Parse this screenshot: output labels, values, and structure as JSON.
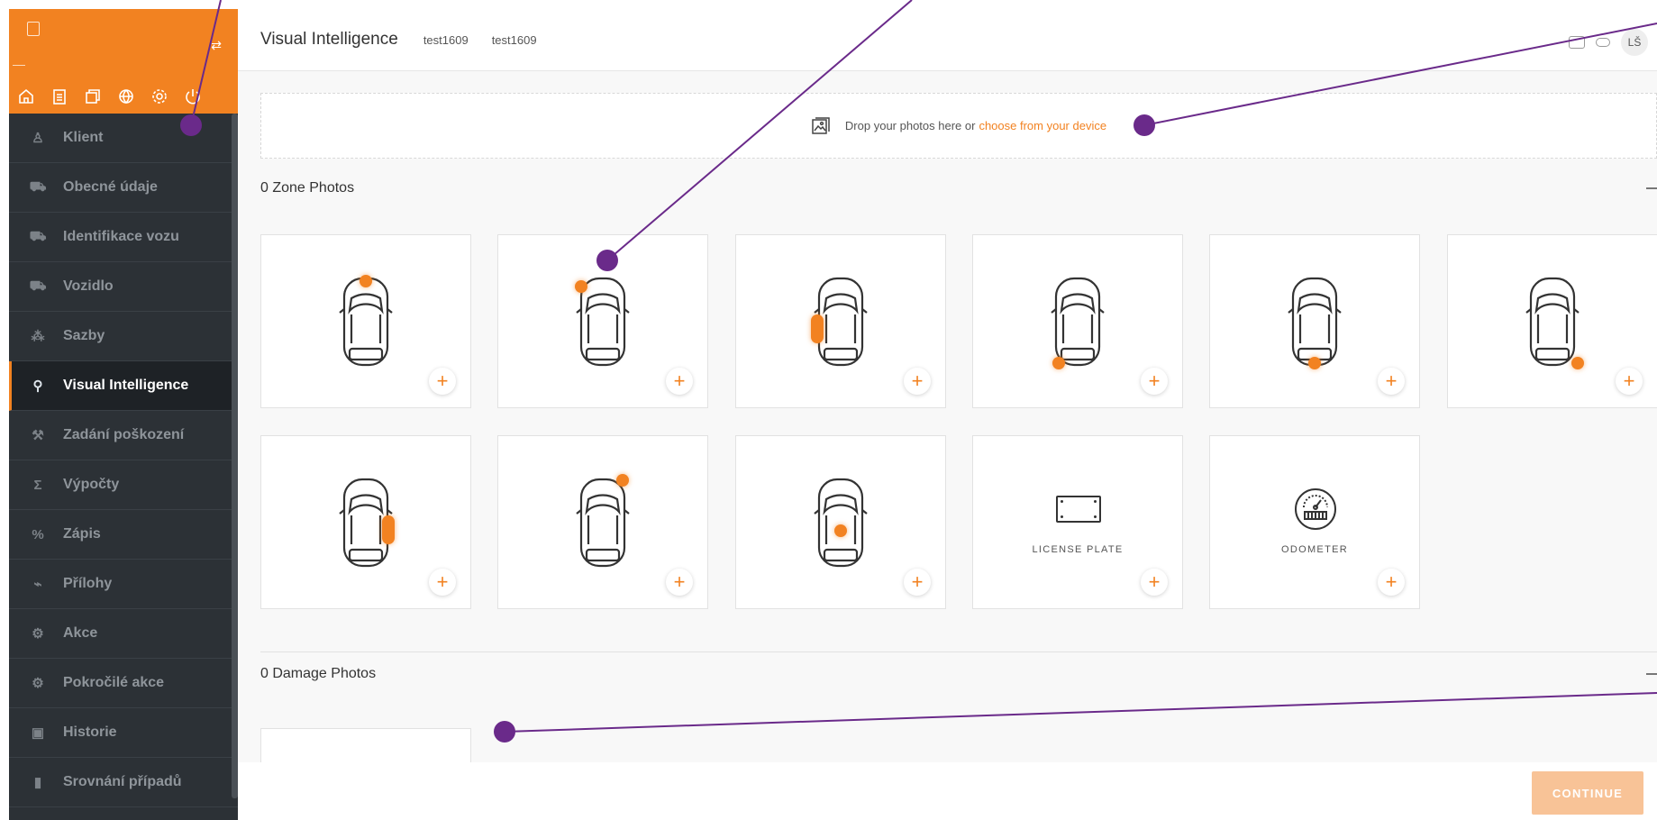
{
  "sidebar": {
    "items": [
      {
        "label": "Klient",
        "icon": "person-icon"
      },
      {
        "label": "Obecné údaje",
        "icon": "car-front-icon"
      },
      {
        "label": "Identifikace vozu",
        "icon": "car-front-icon"
      },
      {
        "label": "Vozidlo",
        "icon": "car-front-icon"
      },
      {
        "label": "Sazby",
        "icon": "coins-icon"
      },
      {
        "label": "Visual Intelligence",
        "icon": "magnifier-icon"
      },
      {
        "label": "Zadání poškození",
        "icon": "hammer-icon"
      },
      {
        "label": "Výpočty",
        "icon": "sigma-icon"
      },
      {
        "label": "Zápis",
        "icon": "percent-icon"
      },
      {
        "label": "Přílohy",
        "icon": "paperclip-icon"
      },
      {
        "label": "Akce",
        "icon": "gears-icon"
      },
      {
        "label": "Pokročilé akce",
        "icon": "advanced-icon"
      },
      {
        "label": "Historie",
        "icon": "history-icon"
      },
      {
        "label": "Srovnání případů",
        "icon": "bars-icon"
      }
    ],
    "active_index": 5
  },
  "header": {
    "title": "Visual Intelligence",
    "crumb1": "test1609",
    "crumb2": "test1609",
    "avatar": "LŠ"
  },
  "dropzone": {
    "text": "Drop your photos here or",
    "link": "choose from your device"
  },
  "zone_section": {
    "title": "0 Zone Photos"
  },
  "damage_section": {
    "title": "0 Damage Photos"
  },
  "cards": {
    "license_plate": "LICENSE PLATE",
    "odometer": "ODOMETER",
    "plus": "+"
  },
  "footer": {
    "continue_label": "CONTINUE"
  },
  "colors": {
    "accent": "#f28221",
    "sidebar_bg": "#2c3136",
    "annotation": "#6a2a8a"
  }
}
